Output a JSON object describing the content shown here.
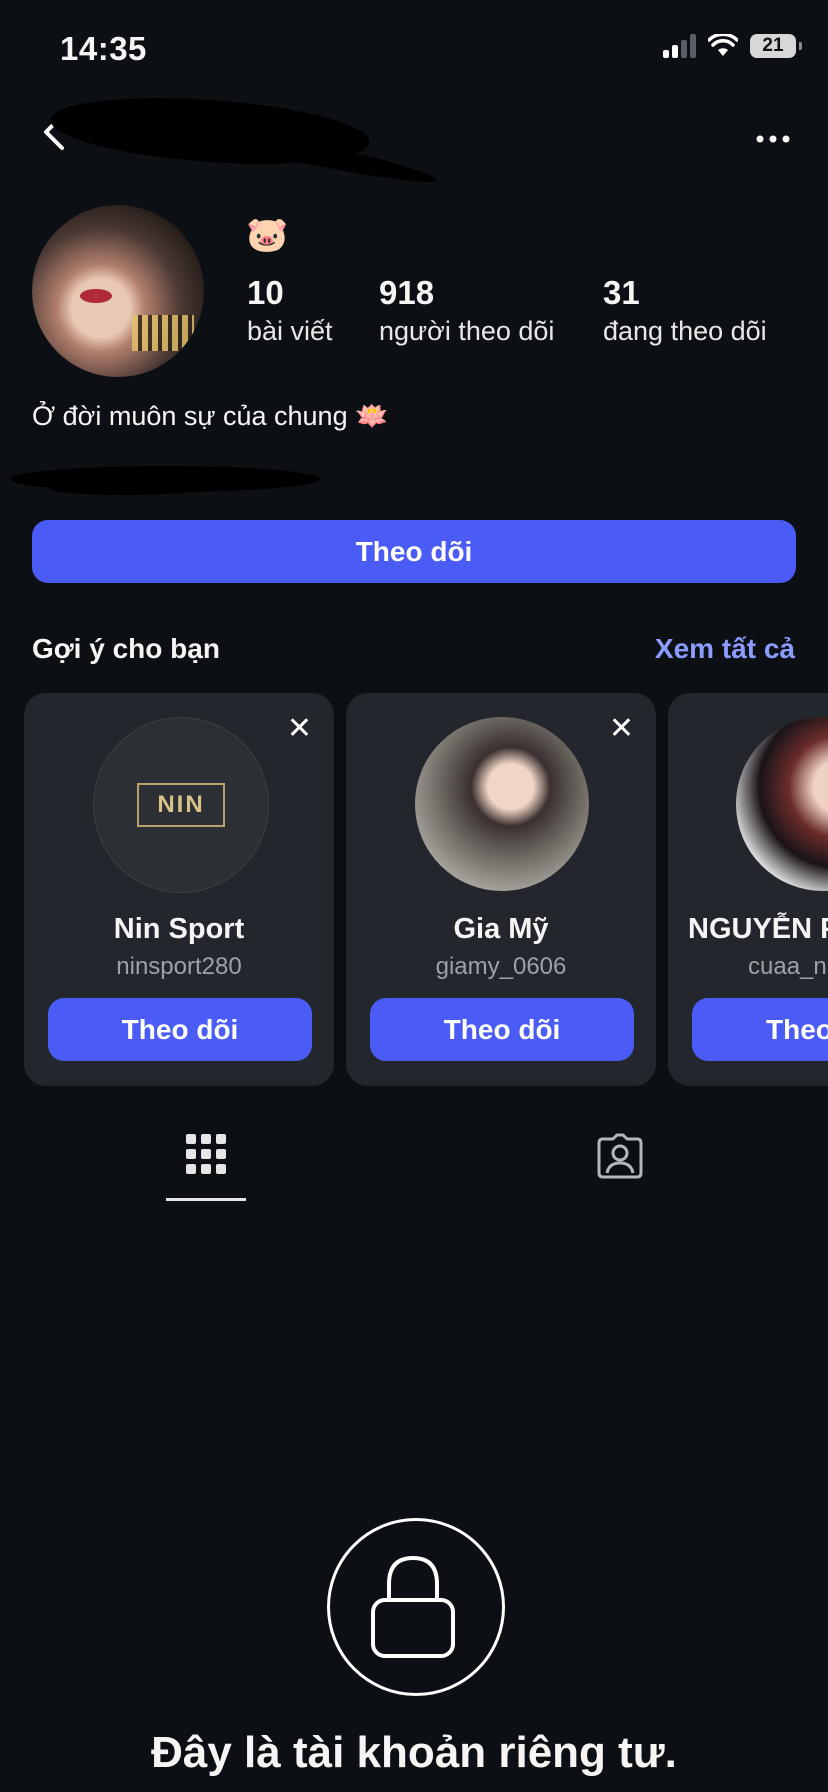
{
  "status_bar": {
    "time": "14:35",
    "battery": "21"
  },
  "profile": {
    "emoji": "🐷",
    "stats": [
      {
        "value": "10",
        "label": "bài viết"
      },
      {
        "value": "918",
        "label": "người theo dõi"
      },
      {
        "value": "31",
        "label": "đang theo dõi"
      }
    ],
    "bio": "Ở đời muôn sự của chung 🪷",
    "follow_label": "Theo dõi"
  },
  "suggestions": {
    "title": "Gợi ý cho bạn",
    "see_all": "Xem tất cả",
    "cards": [
      {
        "name": "Nin Sport",
        "username": "ninsport280",
        "button": "Theo dõi",
        "close": "✕",
        "logo_text": "NIN"
      },
      {
        "name": "Gia Mỹ",
        "username": "giamy_0606",
        "button": "Theo dõi",
        "close": "✕"
      },
      {
        "name": "NGUYỄN P",
        "username": "cuaa_n",
        "button": "Theo",
        "close": "✕"
      }
    ]
  },
  "private": {
    "title": "Đây là tài khoản riêng tư."
  },
  "colors": {
    "background": "#0c1014",
    "accent": "#4a5cf5",
    "link": "#8a9cff",
    "card": "#23262c"
  },
  "icons": [
    "back-icon",
    "more-icon",
    "close-icon",
    "grid-icon",
    "tagged-icon",
    "lock-icon",
    "wifi-icon",
    "signal-icon",
    "battery-icon"
  ]
}
